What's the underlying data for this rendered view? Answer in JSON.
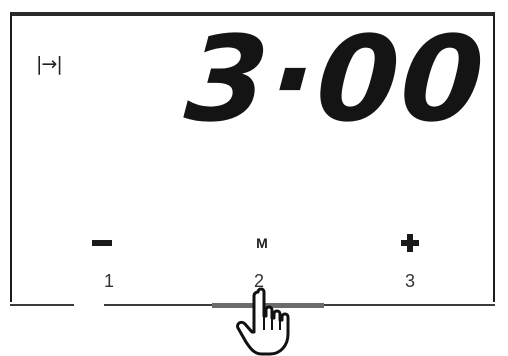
{
  "display": {
    "timer_icon": "|→|",
    "timer_icon_name": "timer-end-icon",
    "time": "3·00"
  },
  "buttons": {
    "minus": {
      "icon": "minus-icon",
      "number": "1"
    },
    "mode": {
      "label": "M",
      "number": "2"
    },
    "plus": {
      "icon": "plus-icon",
      "number": "3"
    }
  },
  "selected_button": "2",
  "pointer_icon": "pointing-hand-icon"
}
